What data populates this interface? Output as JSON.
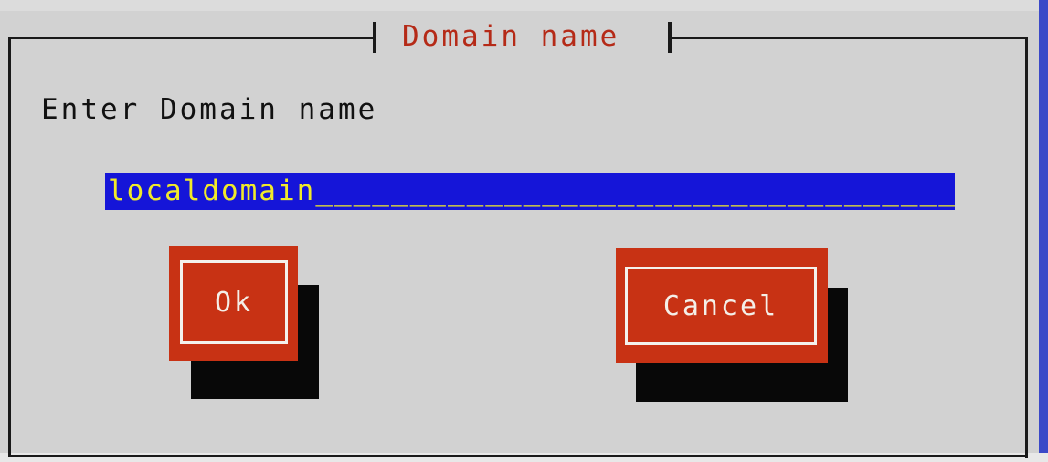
{
  "dialog": {
    "title": "Domain name",
    "prompt": "Enter Domain name"
  },
  "field": {
    "value": "localdomain",
    "fill": "_________________________________________"
  },
  "buttons": {
    "ok_label": "Ok",
    "cancel_label": "Cancel"
  },
  "colors": {
    "background": "#d2d2d2",
    "title_text": "#b52a17",
    "field_bg": "#1515d8",
    "field_text": "#f0ea2a",
    "button_bg": "#c83214",
    "button_text": "#f4efe8",
    "shadow": "#080808",
    "screen_edge": "#3b49c8"
  }
}
